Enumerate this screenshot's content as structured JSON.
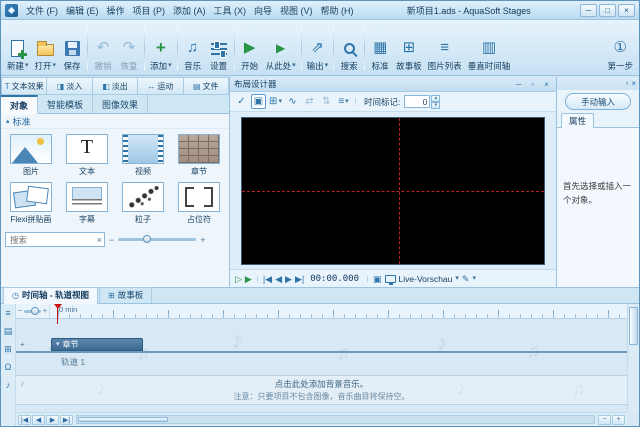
{
  "icons": {
    "caret_down": "▾",
    "caret_up": "▴",
    "minimize": "─",
    "maximize": "□",
    "restore": "▫",
    "close": "×",
    "undo": "↶",
    "redo": "↷",
    "plus": "+",
    "music": "♫",
    "play": "▶",
    "play_outline": "▷",
    "export": "⇗",
    "grid": "▦",
    "storyboard": "⊞",
    "image_list": "≡",
    "vertical_timeline": "▥",
    "first_step": "①",
    "check": "✓",
    "image": "▣",
    "curve": "∿",
    "flip_h": "⇄",
    "flip_v": "⇅",
    "align": "≡",
    "skip_start": "|◀",
    "step_back": "◀",
    "step_fwd": "▶",
    "skip_end": "▶|",
    "fit": "▣",
    "pen": "✎",
    "minus": "−",
    "note1": "♪",
    "note2": "♫",
    "clock": "◷",
    "list": "▤",
    "magnet": "Ω"
  },
  "titlebar": {
    "title": "新项目1.ads - AquaSoft Stages",
    "menus": [
      "文件 (F)",
      "编辑 (E)",
      "操作",
      "项目 (P)",
      "添加 (A)",
      "工具 (X)",
      "向导",
      "视图 (V)",
      "帮助 (H)"
    ]
  },
  "toolbar": {
    "buttons": [
      {
        "label": "新建"
      },
      {
        "label": "打开"
      },
      {
        "label": "保存"
      },
      {
        "label": "撤销"
      },
      {
        "label": "恢复"
      },
      {
        "label": "添加"
      },
      {
        "label": "音乐"
      },
      {
        "label": "设置"
      },
      {
        "label": "开始"
      },
      {
        "label": "从此处"
      },
      {
        "label": "输出"
      },
      {
        "label": "搜索"
      },
      {
        "label": "标准"
      },
      {
        "label": "故事板"
      },
      {
        "label": "图片列表"
      },
      {
        "label": "垂直时间轴"
      },
      {
        "label": "第一步"
      }
    ]
  },
  "left_panel": {
    "effect_tabs": [
      {
        "label": "文本效果",
        "glyph": "T"
      },
      {
        "label": "淡入",
        "glyph": "◨"
      },
      {
        "label": "淡出",
        "glyph": "◧"
      },
      {
        "label": "运动",
        "glyph": "↔"
      },
      {
        "label": "文件",
        "glyph": "▤"
      }
    ],
    "object_tabs": [
      {
        "label": "对象"
      },
      {
        "label": "智能模板"
      },
      {
        "label": "图像效果"
      }
    ],
    "section_title": "标准",
    "items": [
      {
        "label": "图片"
      },
      {
        "label": "文本",
        "glyph": "T"
      },
      {
        "label": "视频"
      },
      {
        "label": "章节"
      },
      {
        "label": "Flexi拼贴画"
      },
      {
        "label": "字幕"
      },
      {
        "label": "粒子"
      },
      {
        "label": "占位符"
      }
    ],
    "search_placeholder": "搜索"
  },
  "designer": {
    "title": "布局设计器",
    "time_marker_label": "时间标记:",
    "time_marker_value": "0",
    "time_display": "00:00.000",
    "live_preview": "Live-Vorschau"
  },
  "right_panel": {
    "manual_input": "手动输入",
    "properties_tab": "属性",
    "message": "首先选择或插入一个对象。"
  },
  "timeline": {
    "tabs": [
      "时间轴 - 轨道视图",
      "故事板"
    ],
    "ruler_start": "0 min",
    "chapter_label": "章节",
    "track_label": "轨道 1",
    "hint_line1": "点击此处添加背景音乐。",
    "hint_line2": "注意：只要项目不包含图像，音乐曲目将保持空。"
  }
}
